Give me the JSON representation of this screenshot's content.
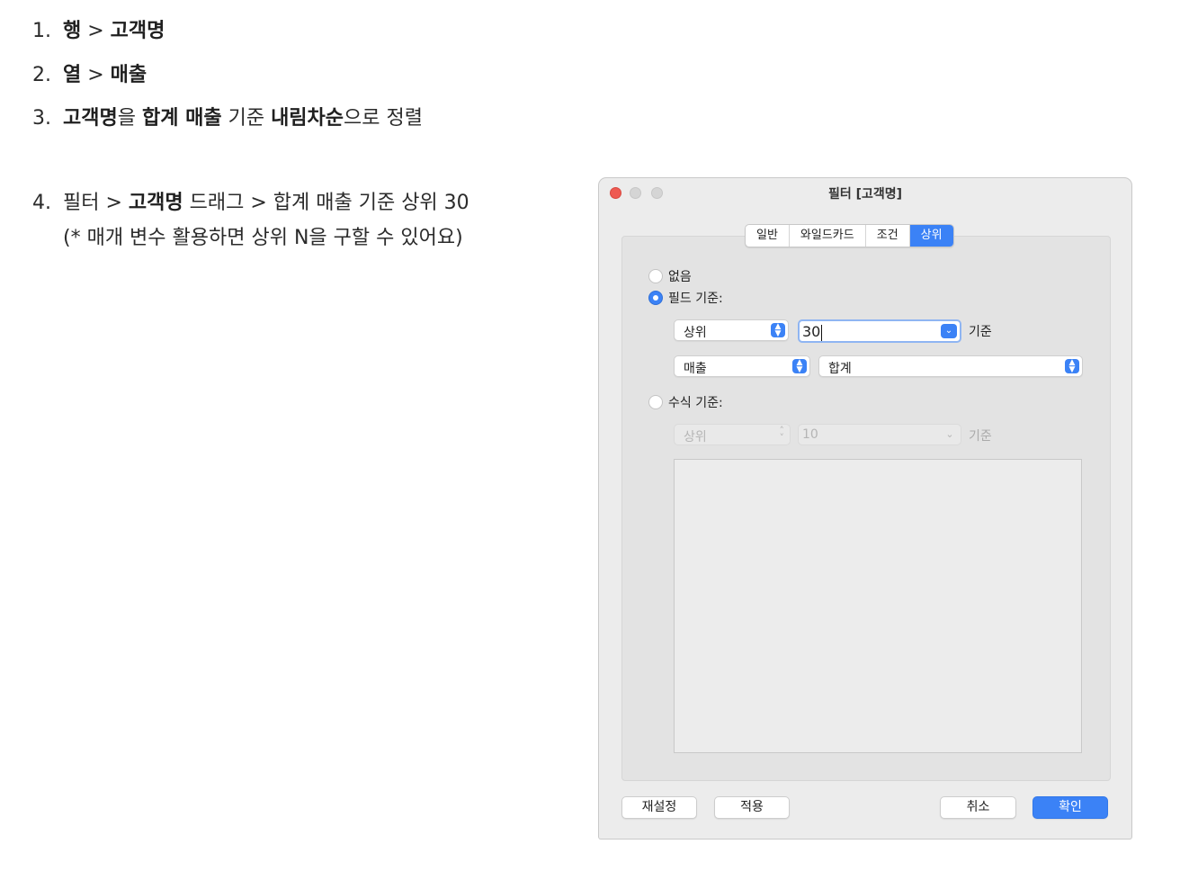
{
  "steps": [
    {
      "num": "1.",
      "p1": "행",
      "p2": " > ",
      "p3": "고객명"
    },
    {
      "num": "2.",
      "p1": "열",
      "p2": " > ",
      "p3": "매출"
    },
    {
      "num": "3.",
      "p1": "고객명",
      "p2": "을 ",
      "p3": "합계 매출",
      "p4": " 기준 ",
      "p5": "내림차순",
      "p6": "으로 정렬"
    },
    {
      "num": "4.",
      "p1": "필터 > ",
      "p2": "고객명",
      "p3": " 드래그 > 합계 매출 기준 상위 30",
      "sub": "(* 매개 변수 활용하면 상위 N을 구할 수 있어요)"
    }
  ],
  "dialog": {
    "title": "필터 [고객명]",
    "tabs": [
      "일반",
      "와일드카드",
      "조건",
      "상위"
    ],
    "active_tab": "상위",
    "options": {
      "none": "없음",
      "by_field": "필드 기준:",
      "by_formula": "수식 기준:"
    },
    "selected_option": "by_field",
    "field": {
      "direction": "상위",
      "count": "30",
      "suffix": "기준",
      "measure": "매출",
      "aggregation": "합계"
    },
    "formula": {
      "direction": "상위",
      "count": "10",
      "suffix": "기준"
    },
    "buttons": {
      "reset": "재설정",
      "apply": "적용",
      "cancel": "취소",
      "ok": "확인"
    },
    "colors": {
      "accent": "#3b82f6",
      "close": "#ee5a52"
    }
  }
}
